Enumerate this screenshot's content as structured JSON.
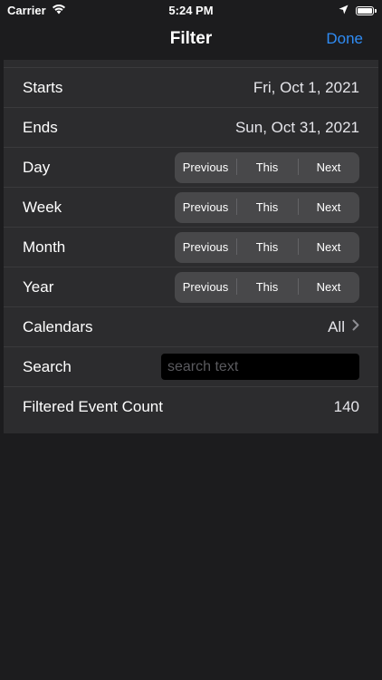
{
  "status_bar": {
    "carrier": "Carrier",
    "time": "5:24 PM"
  },
  "nav": {
    "title": "Filter",
    "done_label": "Done"
  },
  "rows": {
    "starts": {
      "label": "Starts",
      "value": "Fri, Oct 1, 2021"
    },
    "ends": {
      "label": "Ends",
      "value": "Sun, Oct 31, 2021"
    },
    "day": {
      "label": "Day"
    },
    "week": {
      "label": "Week"
    },
    "month": {
      "label": "Month"
    },
    "year": {
      "label": "Year"
    },
    "calendars": {
      "label": "Calendars",
      "value": "All"
    },
    "search": {
      "label": "Search",
      "placeholder": "search text",
      "value": ""
    },
    "count": {
      "label": "Filtered Event Count",
      "value": "140"
    }
  },
  "segment": {
    "previous": "Previous",
    "this": "This",
    "next": "Next"
  },
  "colors": {
    "accent": "#2f8cf5",
    "background": "#1c1c1e",
    "cell": "#2c2c2e"
  }
}
